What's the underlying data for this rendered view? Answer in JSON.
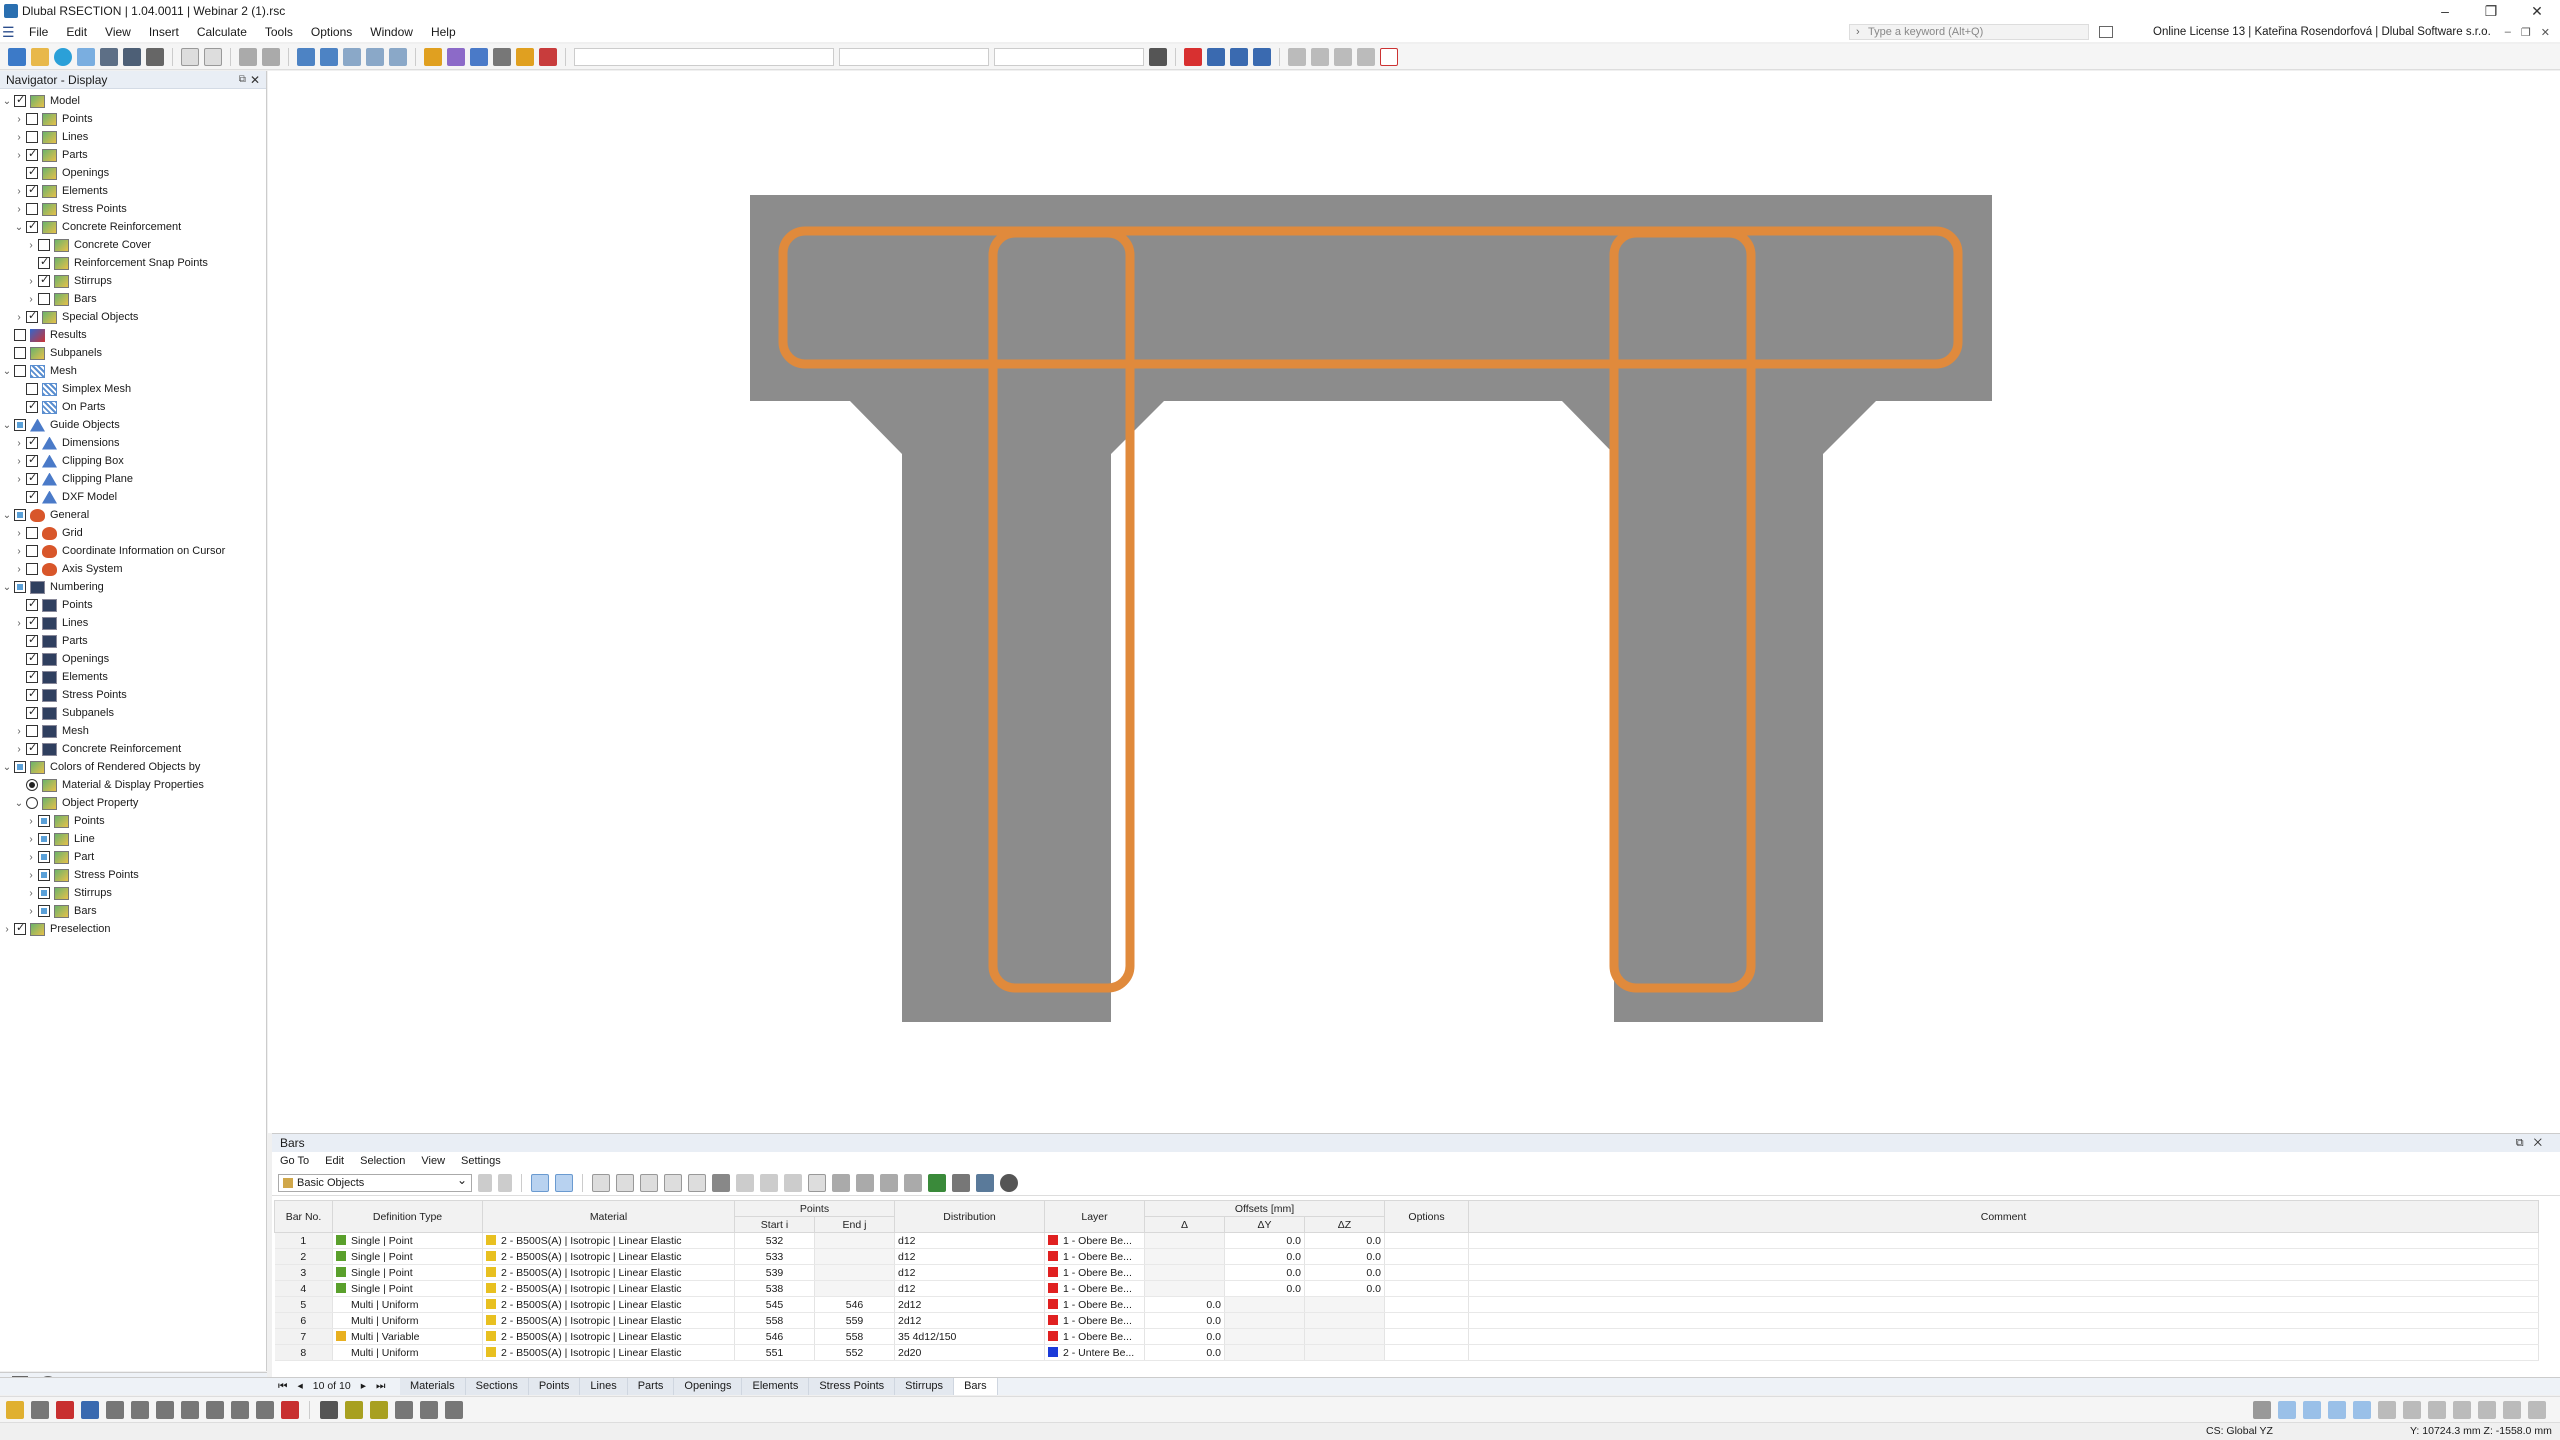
{
  "window": {
    "title": "Dlubal RSECTION | 1.04.0011 | Webinar 2 (1).rsc"
  },
  "menu": [
    "File",
    "Edit",
    "View",
    "Insert",
    "Calculate",
    "Tools",
    "Options",
    "Window",
    "Help"
  ],
  "search": {
    "placeholder": "Type a keyword (Alt+Q)"
  },
  "license": "Online License 13 | Kateřina Rosendorfová | Dlubal Software s.r.o.",
  "navigator": {
    "title": "Navigator - Display",
    "items": [
      {
        "label": "Model",
        "level": 0,
        "state": "checked",
        "exp": "v",
        "icon": "model"
      },
      {
        "label": "Points",
        "level": 1,
        "state": "unchecked",
        "exp": ">",
        "icon": "model"
      },
      {
        "label": "Lines",
        "level": 1,
        "state": "unchecked",
        "exp": ">",
        "icon": "model"
      },
      {
        "label": "Parts",
        "level": 1,
        "state": "checked",
        "exp": ">",
        "icon": "model"
      },
      {
        "label": "Openings",
        "level": 1,
        "state": "checked",
        "exp": "",
        "icon": "model"
      },
      {
        "label": "Elements",
        "level": 1,
        "state": "checked",
        "exp": ">",
        "icon": "model"
      },
      {
        "label": "Stress Points",
        "level": 1,
        "state": "unchecked",
        "exp": ">",
        "icon": "model"
      },
      {
        "label": "Concrete Reinforcement",
        "level": 1,
        "state": "checked",
        "exp": "v",
        "icon": "model"
      },
      {
        "label": "Concrete Cover",
        "level": 2,
        "state": "unchecked",
        "exp": ">",
        "icon": "model"
      },
      {
        "label": "Reinforcement Snap Points",
        "level": 2,
        "state": "checked",
        "exp": "",
        "icon": "model"
      },
      {
        "label": "Stirrups",
        "level": 2,
        "state": "checked",
        "exp": ">",
        "icon": "model"
      },
      {
        "label": "Bars",
        "level": 2,
        "state": "unchecked",
        "exp": ">",
        "icon": "model"
      },
      {
        "label": "Special Objects",
        "level": 1,
        "state": "checked",
        "exp": ">",
        "icon": "model"
      },
      {
        "label": "Results",
        "level": 0,
        "state": "unchecked",
        "exp": "",
        "icon": "res"
      },
      {
        "label": "Subpanels",
        "level": 0,
        "state": "unchecked",
        "exp": "",
        "icon": "model"
      },
      {
        "label": "Mesh",
        "level": 0,
        "state": "unchecked",
        "exp": "v",
        "icon": "mesh"
      },
      {
        "label": "Simplex Mesh",
        "level": 1,
        "state": "unchecked",
        "exp": "",
        "icon": "mesh"
      },
      {
        "label": "On Parts",
        "level": 1,
        "state": "checked",
        "exp": "",
        "icon": "mesh"
      },
      {
        "label": "Guide Objects",
        "level": 0,
        "state": "partial",
        "exp": "v",
        "icon": "guide"
      },
      {
        "label": "Dimensions",
        "level": 1,
        "state": "checked",
        "exp": ">",
        "icon": "guide"
      },
      {
        "label": "Clipping Box",
        "level": 1,
        "state": "checked",
        "exp": ">",
        "icon": "guide"
      },
      {
        "label": "Clipping Plane",
        "level": 1,
        "state": "checked",
        "exp": ">",
        "icon": "guide"
      },
      {
        "label": "DXF Model",
        "level": 1,
        "state": "checked",
        "exp": "",
        "icon": "guide"
      },
      {
        "label": "General",
        "level": 0,
        "state": "partial",
        "exp": "v",
        "icon": "gen"
      },
      {
        "label": "Grid",
        "level": 1,
        "state": "unchecked",
        "exp": ">",
        "icon": "gen"
      },
      {
        "label": "Coordinate Information on Cursor",
        "level": 1,
        "state": "unchecked",
        "exp": ">",
        "icon": "gen"
      },
      {
        "label": "Axis System",
        "level": 1,
        "state": "unchecked",
        "exp": ">",
        "icon": "gen"
      },
      {
        "label": "Numbering",
        "level": 0,
        "state": "partial",
        "exp": "v",
        "icon": "num"
      },
      {
        "label": "Points",
        "level": 1,
        "state": "checked",
        "exp": "",
        "icon": "num"
      },
      {
        "label": "Lines",
        "level": 1,
        "state": "checked",
        "exp": ">",
        "icon": "num"
      },
      {
        "label": "Parts",
        "level": 1,
        "state": "checked",
        "exp": "",
        "icon": "num"
      },
      {
        "label": "Openings",
        "level": 1,
        "state": "checked",
        "exp": "",
        "icon": "num"
      },
      {
        "label": "Elements",
        "level": 1,
        "state": "checked",
        "exp": "",
        "icon": "num"
      },
      {
        "label": "Stress Points",
        "level": 1,
        "state": "checked",
        "exp": "",
        "icon": "num"
      },
      {
        "label": "Subpanels",
        "level": 1,
        "state": "checked",
        "exp": "",
        "icon": "num"
      },
      {
        "label": "Mesh",
        "level": 1,
        "state": "unchecked",
        "exp": ">",
        "icon": "num"
      },
      {
        "label": "Concrete Reinforcement",
        "level": 1,
        "state": "checked",
        "exp": ">",
        "icon": "num"
      },
      {
        "label": "Colors of Rendered Objects by",
        "level": 0,
        "state": "partial",
        "exp": "v",
        "icon": "model"
      },
      {
        "label": "Material & Display Properties",
        "level": 1,
        "state": "radio-on",
        "exp": "",
        "icon": "model"
      },
      {
        "label": "Object Property",
        "level": 1,
        "state": "radio-off",
        "exp": "v",
        "icon": "model"
      },
      {
        "label": "Points",
        "level": 2,
        "state": "partial",
        "exp": ">",
        "icon": "model"
      },
      {
        "label": "Line",
        "level": 2,
        "state": "partial",
        "exp": ">",
        "icon": "model"
      },
      {
        "label": "Part",
        "level": 2,
        "state": "partial",
        "exp": ">",
        "icon": "model"
      },
      {
        "label": "Stress Points",
        "level": 2,
        "state": "partial",
        "exp": ">",
        "icon": "model"
      },
      {
        "label": "Stirrups",
        "level": 2,
        "state": "partial",
        "exp": ">",
        "icon": "model"
      },
      {
        "label": "Bars",
        "level": 2,
        "state": "partial",
        "exp": ">",
        "icon": "model"
      },
      {
        "label": "Preselection",
        "level": 0,
        "state": "checked",
        "exp": ">",
        "icon": "model"
      }
    ]
  },
  "bars_panel": {
    "title": "Bars",
    "menu": [
      "Go To",
      "Edit",
      "Selection",
      "View",
      "Settings"
    ],
    "filter": "Basic Objects",
    "headers": {
      "bar_no": "Bar No.",
      "definition": "Definition Type",
      "material": "Material",
      "points": "Points",
      "start": "Start i",
      "end": "End j",
      "distribution": "Distribution",
      "layer": "Layer",
      "delta": "Δ",
      "offsets": "Offsets [mm]",
      "dy": "ΔY",
      "dz": "ΔZ",
      "options": "Options",
      "comment": "Comment"
    },
    "rows": [
      {
        "no": "1",
        "def": "Single | Point",
        "defcolor": "#5aa02c",
        "mat": "2 - B500S(A) | Isotropic | Linear Elastic",
        "start": "532",
        "end": "",
        "dist": "d12",
        "layer": "1 - Obere Be...",
        "layercolor": "#e02020",
        "delta": "",
        "dy": "0.0",
        "dz": "0.0"
      },
      {
        "no": "2",
        "def": "Single | Point",
        "defcolor": "#5aa02c",
        "mat": "2 - B500S(A) | Isotropic | Linear Elastic",
        "start": "533",
        "end": "",
        "dist": "d12",
        "layer": "1 - Obere Be...",
        "layercolor": "#e02020",
        "delta": "",
        "dy": "0.0",
        "dz": "0.0"
      },
      {
        "no": "3",
        "def": "Single | Point",
        "defcolor": "#5aa02c",
        "mat": "2 - B500S(A) | Isotropic | Linear Elastic",
        "start": "539",
        "end": "",
        "dist": "d12",
        "layer": "1 - Obere Be...",
        "layercolor": "#e02020",
        "delta": "",
        "dy": "0.0",
        "dz": "0.0"
      },
      {
        "no": "4",
        "def": "Single | Point",
        "defcolor": "#5aa02c",
        "mat": "2 - B500S(A) | Isotropic | Linear Elastic",
        "start": "538",
        "end": "",
        "dist": "d12",
        "layer": "1 - Obere Be...",
        "layercolor": "#e02020",
        "delta": "",
        "dy": "0.0",
        "dz": "0.0"
      },
      {
        "no": "5",
        "def": "Multi | Uniform",
        "defcolor": "#ffffff",
        "mat": "2 - B500S(A) | Isotropic | Linear Elastic",
        "start": "545",
        "end": "546",
        "dist": "2d12",
        "layer": "1 - Obere Be...",
        "layercolor": "#e02020",
        "delta": "0.0",
        "dy": "",
        "dz": ""
      },
      {
        "no": "6",
        "def": "Multi | Uniform",
        "defcolor": "#ffffff",
        "mat": "2 - B500S(A) | Isotropic | Linear Elastic",
        "start": "558",
        "end": "559",
        "dist": "2d12",
        "layer": "1 - Obere Be...",
        "layercolor": "#e02020",
        "delta": "0.0",
        "dy": "",
        "dz": ""
      },
      {
        "no": "7",
        "def": "Multi | Variable",
        "defcolor": "#e8b020",
        "mat": "2 - B500S(A) | Isotropic | Linear Elastic",
        "start": "546",
        "end": "558",
        "dist": "35 4d12/150",
        "layer": "1 - Obere Be...",
        "layercolor": "#e02020",
        "delta": "0.0",
        "dy": "",
        "dz": ""
      },
      {
        "no": "8",
        "def": "Multi | Uniform",
        "defcolor": "#ffffff",
        "mat": "2 - B500S(A) | Isotropic | Linear Elastic",
        "start": "551",
        "end": "552",
        "dist": "2d20",
        "layer": "2 - Untere Be...",
        "layercolor": "#1a3ad8",
        "delta": "0.0",
        "dy": "",
        "dz": ""
      }
    ],
    "material_color": "#e8c020"
  },
  "pager": "10 of 10",
  "tabs": [
    "Materials",
    "Sections",
    "Points",
    "Lines",
    "Parts",
    "Openings",
    "Elements",
    "Stress Points",
    "Stirrups",
    "Bars"
  ],
  "active_tab": "Bars",
  "status": {
    "cs": "CS: Global YZ",
    "coords": "Y: 10724.3 mm  Z: -1558.0 mm"
  },
  "section_colors": {
    "concrete": "#8c8c8c",
    "stirrup": "#e08a3c"
  }
}
